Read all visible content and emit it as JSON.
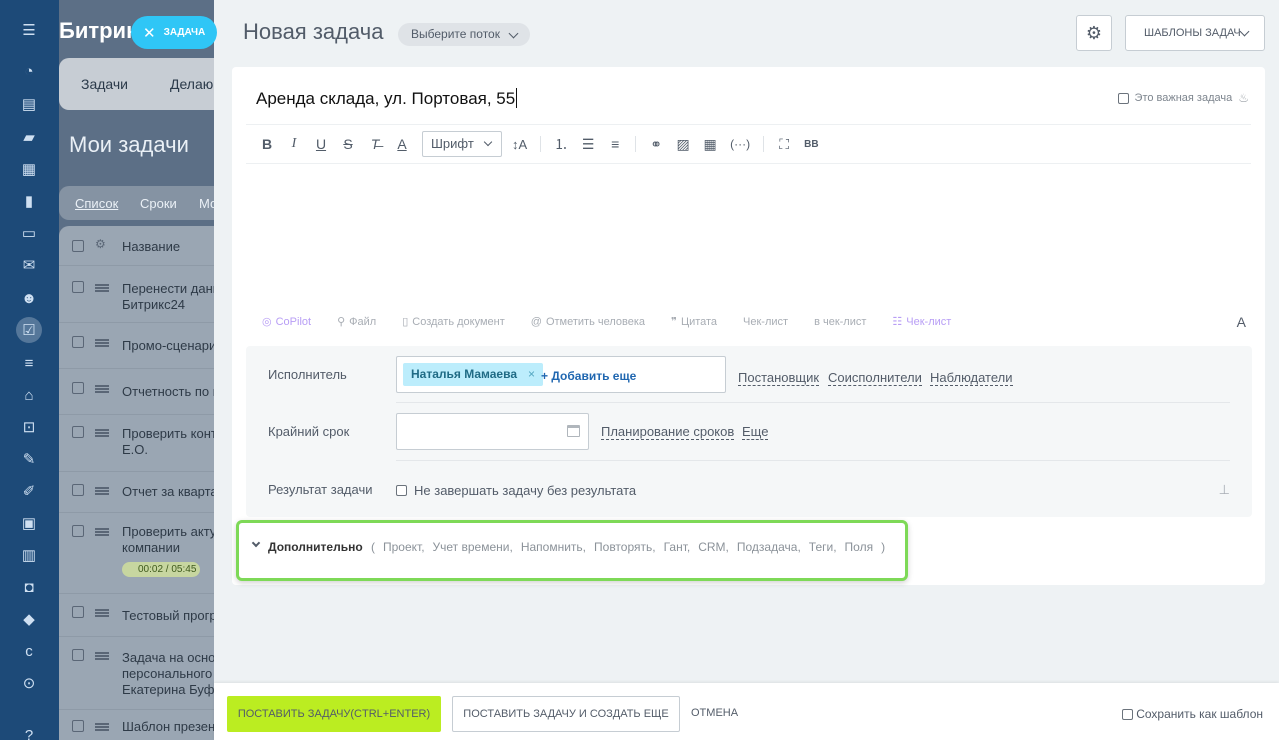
{
  "app": {
    "brand": "Битрикс"
  },
  "close_pill": {
    "label": "ЗАДАЧА"
  },
  "rail": {
    "icons": [
      "menu-icon",
      "pulse-icon",
      "feed-icon",
      "chat-icon",
      "calendar-icon",
      "docs-icon",
      "drive-icon",
      "mail-icon",
      "groups-icon",
      "tasks-icon",
      "crm-icon",
      "store-icon",
      "cart-icon",
      "sign-icon",
      "pen-icon",
      "contact-icon",
      "analytics-icon",
      "robot-icon",
      "box-icon",
      "c-icon",
      "more-icon",
      "help-icon"
    ]
  },
  "background": {
    "topnav": [
      "Задачи",
      "Делаю"
    ],
    "title": "Мои задачи",
    "views": [
      "Список",
      "Сроки",
      "Мо"
    ],
    "header_col": "Название",
    "rows": [
      "Перенести данн\nБитрикс24",
      "Промо-сценари",
      "Отчетность по м",
      "Проверить конт\nЕ.О.",
      "Отчет за квартал",
      "Проверить акту\nкомпании",
      "Тестовый прогр",
      "Задача на основ\nперсонального\nЕкатерина Буфф",
      "Шаблон презен"
    ],
    "timer": "00:02 / 05:45"
  },
  "panel": {
    "title": "Новая задача",
    "flow_select": "Выберите поток",
    "templates_button": "ШАБЛОНЫ ЗАДАЧ"
  },
  "task": {
    "title": "Аренда склада, ул. Портовая, 55",
    "important_label": "Это важная задача"
  },
  "editor": {
    "font_select": "Шрифт",
    "bb_label": "BB"
  },
  "attach": {
    "copilot": "CoPilot",
    "file": "Файл",
    "create_doc": "Создать документ",
    "mention": "Отметить человека",
    "quote": "Цитата",
    "checklist": "Чек-лист",
    "to_checklist": "в чек-лист",
    "checklist2": "Чек-лист",
    "font_toggle": "A"
  },
  "fields": {
    "assignee_label": "Исполнитель",
    "assignee_value": "Наталья Мамаева",
    "add_more": "+ Добавить еще",
    "creator": "Постановщик",
    "coexecutors": "Соисполнители",
    "observers": "Наблюдатели",
    "deadline_label": "Крайний срок",
    "planning": "Планирование сроков",
    "more": "Еще",
    "result_label": "Результат задачи",
    "result_check": "Не завершать задачу без результата"
  },
  "extra": {
    "label": "Дополнительно",
    "open_paren": "(",
    "close_paren": ")",
    "items": [
      "Проект,",
      "Учет времени,",
      "Напомнить,",
      "Повторять,",
      "Гант,",
      "CRM,",
      "Подзадача,",
      "Теги,",
      "Поля"
    ]
  },
  "footer": {
    "submit": "ПОСТАВИТЬ ЗАДАЧУ(CTRL+ENTER)",
    "submit_more": "ПОСТАВИТЬ ЗАДАЧУ И СОЗДАТЬ ЕЩЕ",
    "cancel": "ОТМЕНА",
    "save_template": "Сохранить как шаблон"
  },
  "colors": {
    "accent_green": "#bbed21",
    "highlight": "#7ed957",
    "rail": "#1d4a78",
    "pill": "#2fc6f6"
  }
}
